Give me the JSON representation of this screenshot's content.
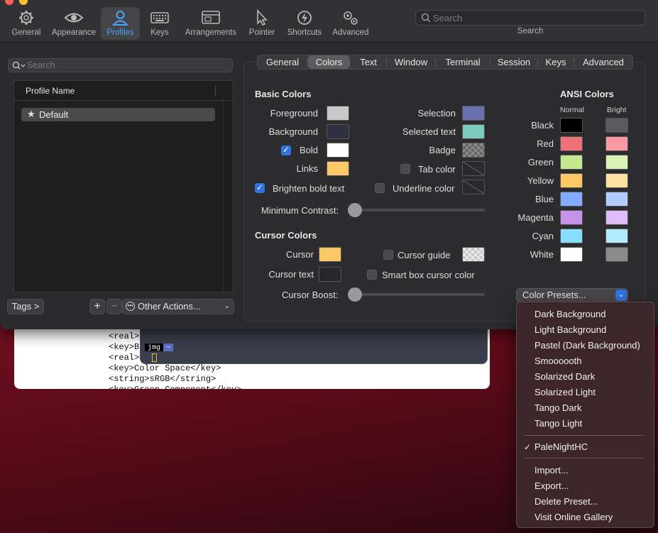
{
  "toolbar": {
    "items": [
      {
        "label": "General",
        "icon": "gear-icon"
      },
      {
        "label": "Appearance",
        "icon": "eye-icon"
      },
      {
        "label": "Profiles",
        "icon": "person-icon"
      },
      {
        "label": "Keys",
        "icon": "keyboard-icon"
      },
      {
        "label": "Arrangements",
        "icon": "windows-icon"
      },
      {
        "label": "Pointer",
        "icon": "pointer-icon"
      },
      {
        "label": "Shortcuts",
        "icon": "bolt-icon"
      },
      {
        "label": "Advanced",
        "icon": "gears-icon"
      }
    ],
    "active": "Profiles",
    "search_placeholder": "Search",
    "search_caption": "Search"
  },
  "profiles": {
    "search_placeholder": "Search",
    "column_header": "Profile Name",
    "items": [
      {
        "name": "Default",
        "default": true
      }
    ],
    "tags_button": "Tags >",
    "add_button": "+",
    "remove_button": "−",
    "other_actions": "Other Actions..."
  },
  "tabs": {
    "items": [
      "General",
      "Colors",
      "Text",
      "Window",
      "Terminal",
      "Session",
      "Keys",
      "Advanced"
    ],
    "active": "Colors"
  },
  "basic_colors": {
    "heading": "Basic Colors",
    "foreground_label": "Foreground",
    "foreground_color": "#c8c8c8",
    "background_label": "Background",
    "background_color": "#2f3142",
    "bold_label": "Bold",
    "bold_checked": true,
    "bold_color": "#ffffff",
    "links_label": "Links",
    "links_color": "#fcc866",
    "selection_label": "Selection",
    "selection_color": "#6870ad",
    "selected_text_label": "Selected text",
    "selected_text_color": "#7dcbbf",
    "badge_label": "Badge",
    "tab_color_label": "Tab color",
    "tab_color_checked": false,
    "underline_color_label": "Underline color",
    "underline_color_checked": false,
    "brighten_bold_label": "Brighten bold text",
    "brighten_bold_checked": true,
    "minimum_contrast_label": "Minimum Contrast:",
    "minimum_contrast_value": 0
  },
  "cursor_colors": {
    "heading": "Cursor Colors",
    "cursor_label": "Cursor",
    "cursor_color": "#fcc866",
    "cursor_text_label": "Cursor text",
    "cursor_text_color": "#262728",
    "cursor_guide_label": "Cursor guide",
    "cursor_guide_checked": false,
    "smart_box_label": "Smart box cursor color",
    "smart_box_checked": false,
    "cursor_boost_label": "Cursor Boost:",
    "cursor_boost_value": 0
  },
  "ansi": {
    "heading": "ANSI Colors",
    "normal_label": "Normal",
    "bright_label": "Bright",
    "rows": [
      {
        "name": "Black",
        "normal": "#000000",
        "bright": "#5a5a5c"
      },
      {
        "name": "Red",
        "normal": "#f0717a",
        "bright": "#f89aa2"
      },
      {
        "name": "Green",
        "normal": "#c3e88d",
        "bright": "#dbf2b6"
      },
      {
        "name": "Yellow",
        "normal": "#fcc866",
        "bright": "#fde0a4"
      },
      {
        "name": "Blue",
        "normal": "#82aaff",
        "bright": "#b3ccff"
      },
      {
        "name": "Magenta",
        "normal": "#c792ea",
        "bright": "#ddbbf4"
      },
      {
        "name": "Cyan",
        "normal": "#89ddff",
        "bright": "#b4ebff"
      },
      {
        "name": "White",
        "normal": "#ffffff",
        "bright": "#8a8a8a"
      }
    ]
  },
  "presets": {
    "button_label": "Color Presets...",
    "menu_builtin": [
      "Dark Background",
      "Light Background",
      "Pastel (Dark Background)",
      "Smoooooth",
      "Solarized Dark",
      "Solarized Light",
      "Tango Dark",
      "Tango Light"
    ],
    "menu_custom": [
      "PaleNightHC"
    ],
    "selected": "PaleNightHC",
    "menu_actions": [
      "Import...",
      "Export...",
      "Delete Preset...",
      "Visit Online Gallery"
    ]
  },
  "background": {
    "doc_lines": [
      "<real>",
      "<key>B",
      "<real>",
      "<key>Color Space</key>",
      "<string>sRGB</string>",
      "<key>Green Component</key>"
    ],
    "term_prompt_user": "jmg",
    "term_prompt_dir": "~"
  }
}
